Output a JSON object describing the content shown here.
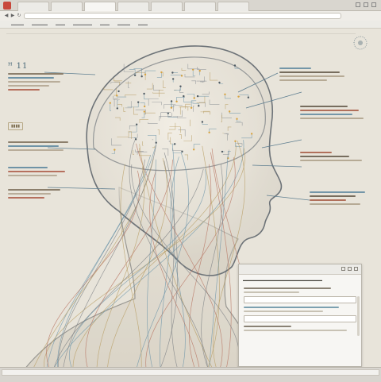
{
  "window": {
    "tabs": [
      "",
      "",
      "",
      "",
      "",
      "",
      ""
    ],
    "active_tab": 2
  },
  "left_panel": {
    "ref_mark": "ꟸ 11"
  },
  "colors": {
    "background": "#e9e5dc",
    "head_stroke": "#6d7378",
    "wire_blue": "#6a93a8",
    "wire_gold": "#b79c62",
    "wire_red": "#b6705e",
    "accent_orange": "#d9a441"
  },
  "icons": [
    "app-icon",
    "back-icon",
    "forward-icon",
    "reload-icon",
    "minimize-icon",
    "maximize-icon",
    "close-icon",
    "compass-icon"
  ]
}
